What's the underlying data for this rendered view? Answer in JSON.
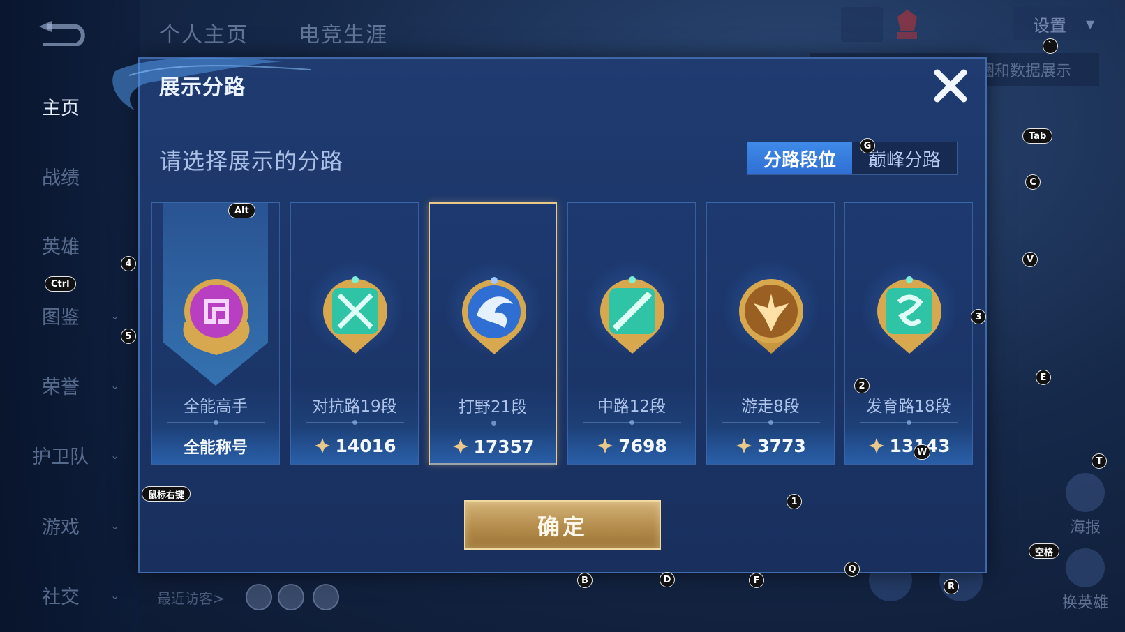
{
  "header": {
    "tabs": [
      "个人主页",
      "电竞生涯"
    ],
    "settings_label": "设置",
    "faded_banner_text": "圈和数据展示"
  },
  "sidebar": {
    "items": [
      {
        "label": "主页",
        "active": true,
        "has_chevron": false
      },
      {
        "label": "战绩",
        "active": false,
        "has_chevron": false
      },
      {
        "label": "英雄",
        "active": false,
        "has_chevron": false
      },
      {
        "label": "图鉴",
        "active": false,
        "has_chevron": true
      },
      {
        "label": "荣誉",
        "active": false,
        "has_chevron": true
      },
      {
        "label": "护卫队",
        "active": false,
        "has_chevron": true
      },
      {
        "label": "游戏",
        "active": false,
        "has_chevron": true
      },
      {
        "label": "社交",
        "active": false,
        "has_chevron": true
      }
    ]
  },
  "visitors_label": "最近访客>",
  "right_actions": [
    "海报",
    "换英雄"
  ],
  "modal": {
    "title": "展示分路",
    "prompt": "请选择展示的分路",
    "segments": [
      "分路段位",
      "巅峰分路"
    ],
    "active_segment": 0,
    "confirm_label": "确定",
    "cards": [
      {
        "name": "全能高手",
        "bottom": "全能称号",
        "score": null,
        "selected": false,
        "badge_color": "#b83fc2",
        "icon": "versatile-badge-icon"
      },
      {
        "name": "对抗路19段",
        "bottom": null,
        "score": "14016",
        "selected": false,
        "badge_color": "#2fc4a6",
        "icon": "clash-lane-badge-icon"
      },
      {
        "name": "打野21段",
        "bottom": null,
        "score": "17357",
        "selected": true,
        "badge_color": "#2f6fd3",
        "icon": "jungle-badge-icon"
      },
      {
        "name": "中路12段",
        "bottom": null,
        "score": "7698",
        "selected": false,
        "badge_color": "#2fc4a6",
        "icon": "mid-lane-badge-icon"
      },
      {
        "name": "游走8段",
        "bottom": null,
        "score": "3773",
        "selected": false,
        "badge_color": "#c88c3c",
        "icon": "roam-badge-icon"
      },
      {
        "name": "发育路18段",
        "bottom": null,
        "score": "13143",
        "selected": false,
        "badge_color": "#2fc4a6",
        "icon": "farm-lane-badge-icon"
      }
    ]
  },
  "key_hints": [
    "Alt",
    "Ctrl",
    "4",
    "5",
    "3",
    "2",
    "1",
    "G",
    "Tab",
    "C",
    "V",
    "E",
    "T",
    "W",
    "鼠标右键",
    "空格",
    "B",
    "D",
    "F",
    "Q",
    "R",
    "`"
  ]
}
